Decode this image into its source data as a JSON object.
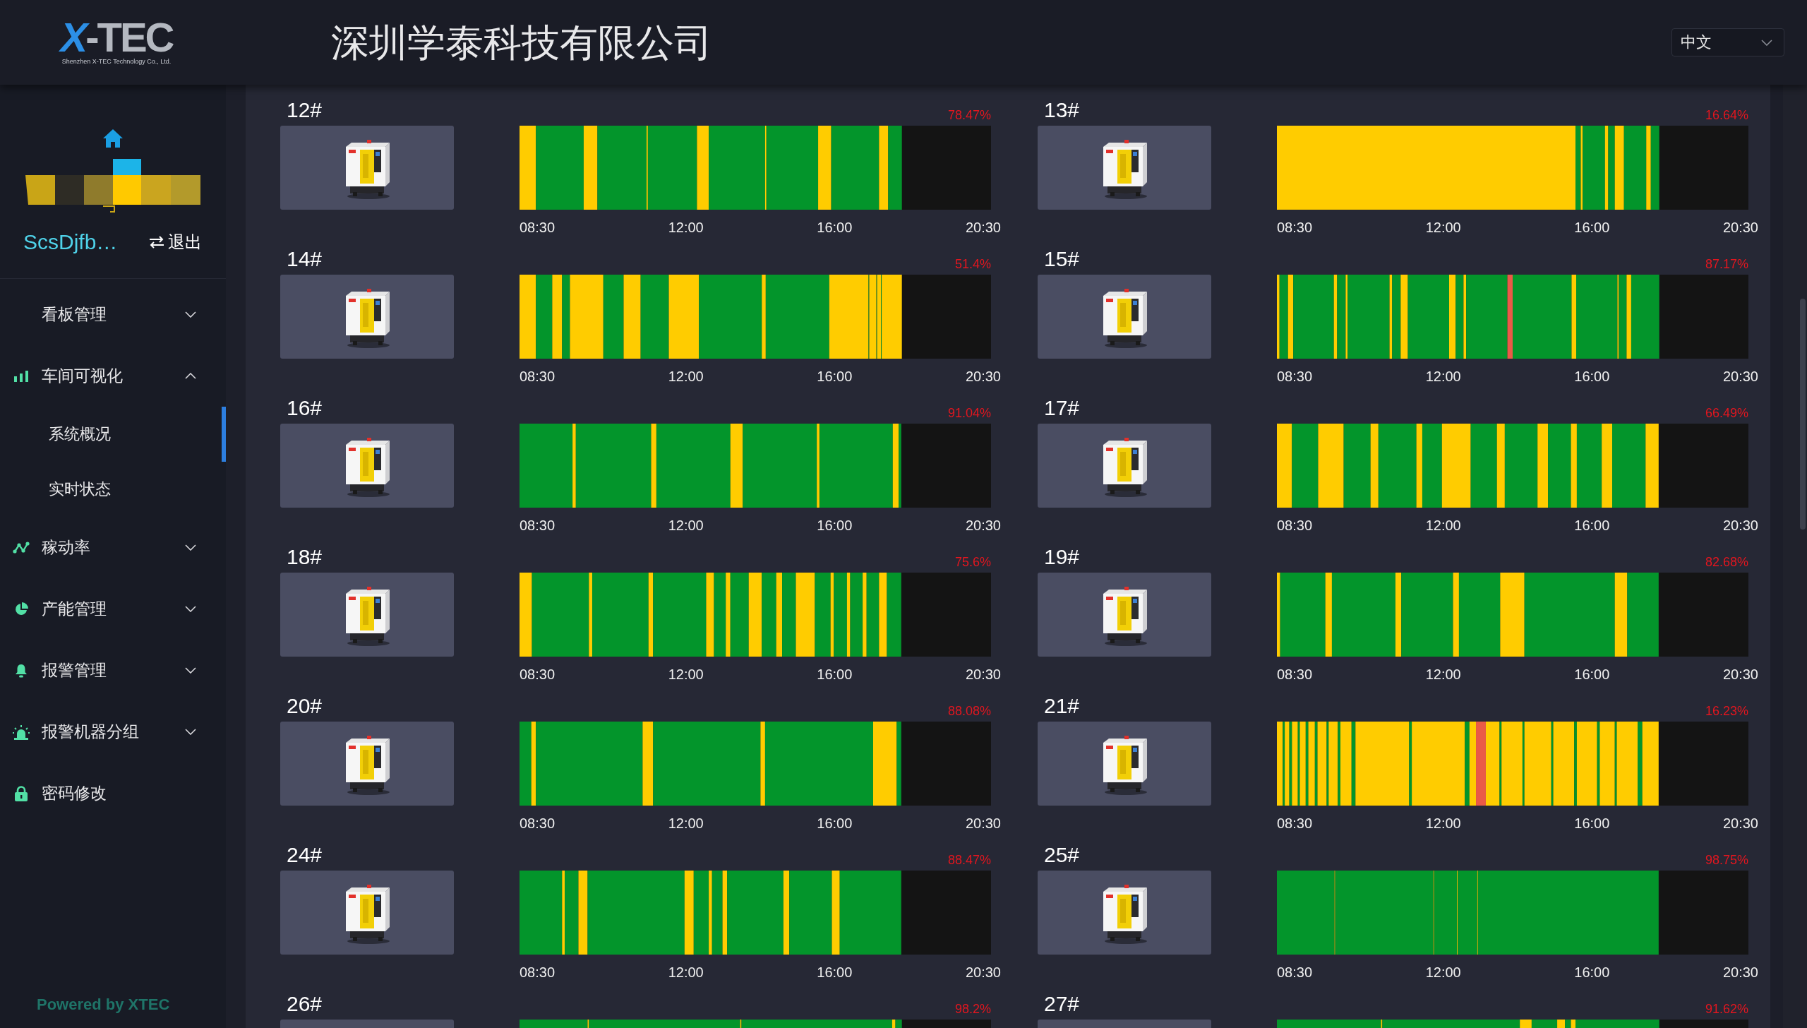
{
  "header": {
    "logo": {
      "mark": "X",
      "word": "-TEC",
      "tagline": "Shenzhen X-TEC Technology Co., Ltd."
    },
    "title": "深圳学泰科技有限公司",
    "language": {
      "value": "中文"
    }
  },
  "sidebar": {
    "user": {
      "name": "ScsDjfb…",
      "logout": "退出"
    },
    "menu": [
      {
        "label": "看板管理",
        "expanded": false,
        "selected": false
      },
      {
        "label": "车间可视化",
        "expanded": true,
        "selected": false,
        "children": [
          {
            "label": "系统概况",
            "selected": true
          },
          {
            "label": "实时状态",
            "selected": false
          }
        ]
      },
      {
        "label": "稼动率",
        "expanded": false,
        "selected": false
      },
      {
        "label": "产能管理",
        "expanded": false,
        "selected": false
      },
      {
        "label": "报警管理",
        "expanded": false,
        "selected": false
      },
      {
        "label": "报警机器分组",
        "expanded": false,
        "selected": false
      },
      {
        "label": "密码修改",
        "selected": false
      }
    ],
    "footer": "Powered by XTEC"
  },
  "machines": [
    {
      "name": "12#",
      "utilization": "78.47%",
      "axis_labels": [
        "08:30",
        "12:00",
        "16:00",
        "20:30"
      ]
    },
    {
      "name": "13#",
      "utilization": "16.64%",
      "axis_labels": [
        "08:30",
        "12:00",
        "16:00",
        "20:30"
      ]
    },
    {
      "name": "14#",
      "utilization": "51.4%",
      "axis_labels": [
        "08:30",
        "12:00",
        "16:00",
        "20:30"
      ]
    },
    {
      "name": "15#",
      "utilization": "87.17%",
      "axis_labels": [
        "08:30",
        "12:00",
        "16:00",
        "20:30"
      ]
    },
    {
      "name": "16#",
      "utilization": "91.04%",
      "axis_labels": [
        "08:30",
        "12:00",
        "16:00",
        "20:30"
      ]
    },
    {
      "name": "17#",
      "utilization": "66.49%",
      "axis_labels": [
        "08:30",
        "12:00",
        "16:00",
        "20:30"
      ]
    },
    {
      "name": "18#",
      "utilization": "75.6%",
      "axis_labels": [
        "08:30",
        "12:00",
        "16:00",
        "20:30"
      ]
    },
    {
      "name": "19#",
      "utilization": "82.68%",
      "axis_labels": [
        "08:30",
        "12:00",
        "16:00",
        "20:30"
      ]
    },
    {
      "name": "20#",
      "utilization": "88.08%",
      "axis_labels": [
        "08:30",
        "12:00",
        "16:00",
        "20:30"
      ]
    },
    {
      "name": "21#",
      "utilization": "16.23%",
      "axis_labels": [
        "08:30",
        "12:00",
        "16:00",
        "20:30"
      ]
    },
    {
      "name": "24#",
      "utilization": "88.47%",
      "axis_labels": [
        "08:30",
        "12:00",
        "16:00",
        "20:30"
      ]
    },
    {
      "name": "25#",
      "utilization": "98.75%",
      "axis_labels": [
        "08:30",
        "12:00",
        "16:00",
        "20:30"
      ]
    },
    {
      "name": "26#",
      "utilization": "98.2%"
    },
    {
      "name": "27#",
      "utilization": "91.62%"
    }
  ]
}
